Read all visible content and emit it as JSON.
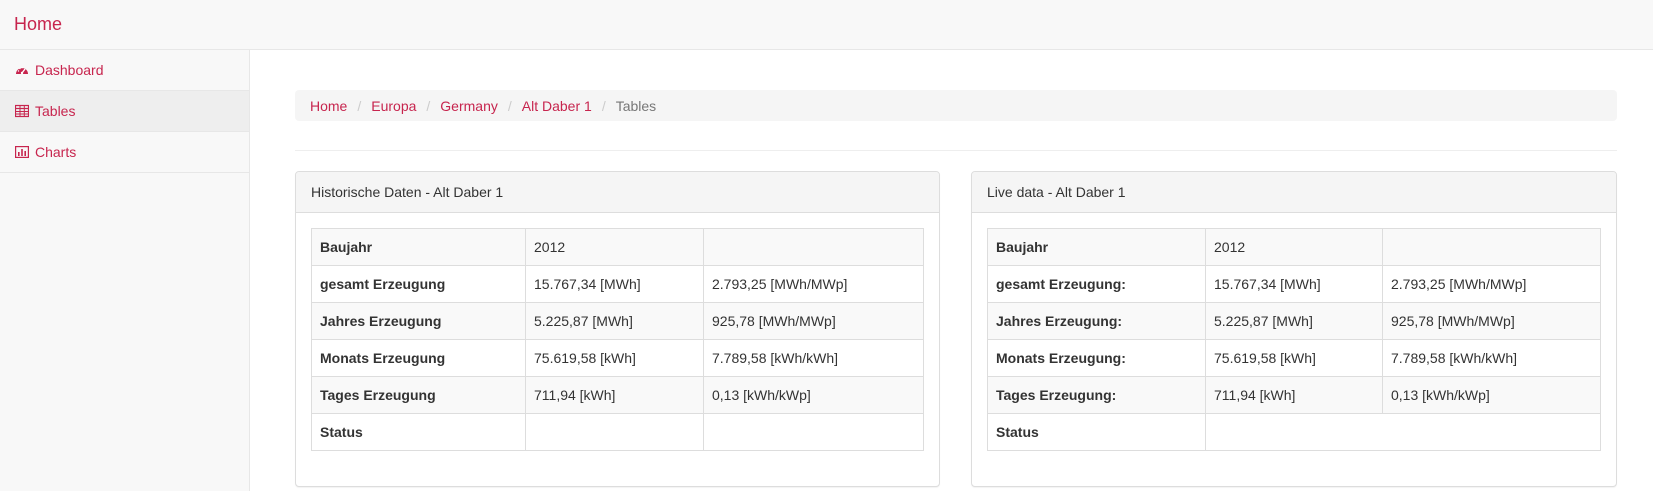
{
  "navbar": {
    "brand": "Home"
  },
  "sidebar": {
    "items": [
      {
        "label": "Dashboard",
        "icon": "dashboard-icon"
      },
      {
        "label": "Tables",
        "icon": "table-icon"
      },
      {
        "label": "Charts",
        "icon": "bar-chart-icon"
      }
    ]
  },
  "breadcrumb": {
    "items": [
      "Home",
      "Europa",
      "Germany",
      "Alt Daber 1"
    ],
    "current": "Tables",
    "separator": "/"
  },
  "historic": {
    "title": "Historische Daten - Alt Daber 1",
    "rows": [
      [
        "Baujahr",
        "2012",
        ""
      ],
      [
        "gesamt Erzeugung",
        "15.767,34 [MWh]",
        "2.793,25 [MWh/MWp]"
      ],
      [
        "Jahres Erzeugung",
        "5.225,87 [MWh]",
        "925,78 [MWh/MWp]"
      ],
      [
        "Monats Erzeugung",
        "75.619,58 [kWh]",
        "7.789,58 [kWh/kWh]"
      ],
      [
        "Tages Erzeugung",
        "711,94 [kWh]",
        "0,13 [kWh/kWp]"
      ],
      [
        "Status",
        "",
        ""
      ]
    ]
  },
  "live": {
    "title": "Live data - Alt Daber 1",
    "rows": [
      [
        "Baujahr",
        "2012",
        ""
      ],
      [
        "gesamt Erzeugung:",
        "15.767,34 [MWh]",
        "2.793,25 [MWh/MWp]"
      ],
      [
        "Jahres Erzeugung:",
        "5.225,87 [MWh]",
        "925,78 [MWh/MWp]"
      ],
      [
        "Monats Erzeugung:",
        "75.619,58 [kWh]",
        "7.789,58 [kWh/kWh]"
      ],
      [
        "Tages Erzeugung:",
        "711,94 [kWh]",
        "0,13 [kWh/kWp]"
      ],
      [
        "Status",
        ""
      ]
    ]
  },
  "colors": {
    "accent": "#c7254e",
    "muted": "#777777"
  }
}
